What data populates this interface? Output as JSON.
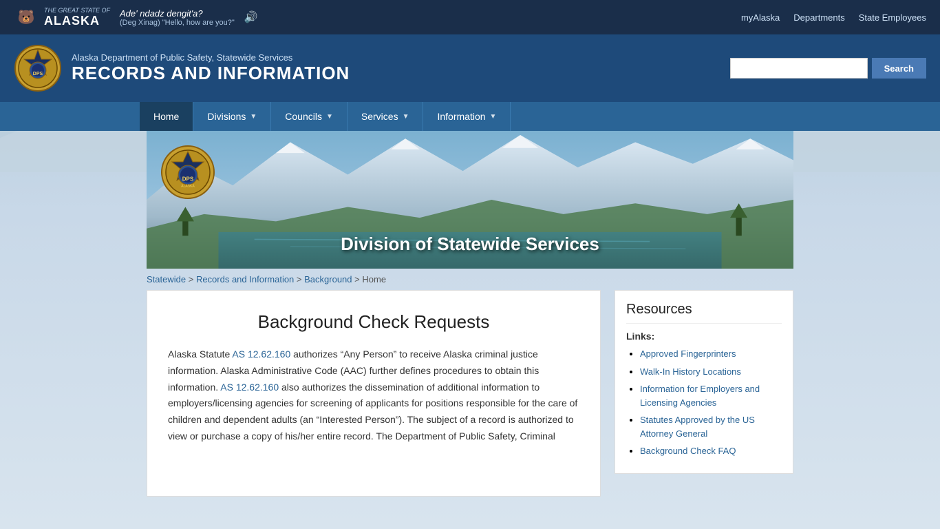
{
  "topbar": {
    "state_name": "ALASKA",
    "state_label": "THE GREAT STATE OF",
    "native_phrase": "Ade' ndadz dengit'a?",
    "native_lang": "(Deg Xinag)",
    "translation": "\"Hello, how are you?\"",
    "nav_links": [
      {
        "label": "myAlaska",
        "href": "#"
      },
      {
        "label": "Departments",
        "href": "#"
      },
      {
        "label": "State Employees",
        "href": "#"
      }
    ]
  },
  "header": {
    "subtitle": "Alaska Department of Public Safety, Statewide Services",
    "main_title": "RECORDS AND INFORMATION",
    "search_placeholder": "",
    "search_button_label": "Search"
  },
  "nav": {
    "items": [
      {
        "label": "Home",
        "has_arrow": false
      },
      {
        "label": "Divisions",
        "has_arrow": true
      },
      {
        "label": "Councils",
        "has_arrow": true
      },
      {
        "label": "Services",
        "has_arrow": true
      },
      {
        "label": "Information",
        "has_arrow": true
      }
    ]
  },
  "hero": {
    "text": "Division of Statewide Services"
  },
  "breadcrumb": {
    "items": [
      {
        "label": "Statewide",
        "href": "#",
        "is_link": true
      },
      {
        "label": "Records and Information",
        "href": "#",
        "is_link": true
      },
      {
        "label": "Background",
        "href": "#",
        "is_link": true
      },
      {
        "label": "Home",
        "is_link": false
      }
    ],
    "separator": " > "
  },
  "main": {
    "heading": "Background Check Requests",
    "body_intro": "Alaska Statute ",
    "statute_link_1": "AS 12.62.160",
    "body_part1": " authorizes “Any Person” to receive Alaska criminal justice information. Alaska Administrative Code (AAC) further defines procedures to obtain this information. ",
    "statute_link_2": "AS 12.62.160",
    "body_part2": " also authorizes the dissemination of additional information to employers/licensing agencies for screening of applicants for positions responsible for the care of children and dependent adults (an “Interested Person”). The subject of a record is authorized to view or purchase a copy of his/her entire record. The Department of Public Safety, Criminal"
  },
  "sidebar": {
    "resources_heading": "Resources",
    "links_label": "Links:",
    "links": [
      {
        "label": "Approved Fingerprinters",
        "href": "#"
      },
      {
        "label": "Walk-In History Locations",
        "href": "#"
      },
      {
        "label": "Information for Employers and Licensing Agencies",
        "href": "#"
      },
      {
        "label": "Statutes Approved by the US Attorney General",
        "href": "#"
      },
      {
        "label": "Background Check FAQ",
        "href": "#"
      }
    ]
  }
}
